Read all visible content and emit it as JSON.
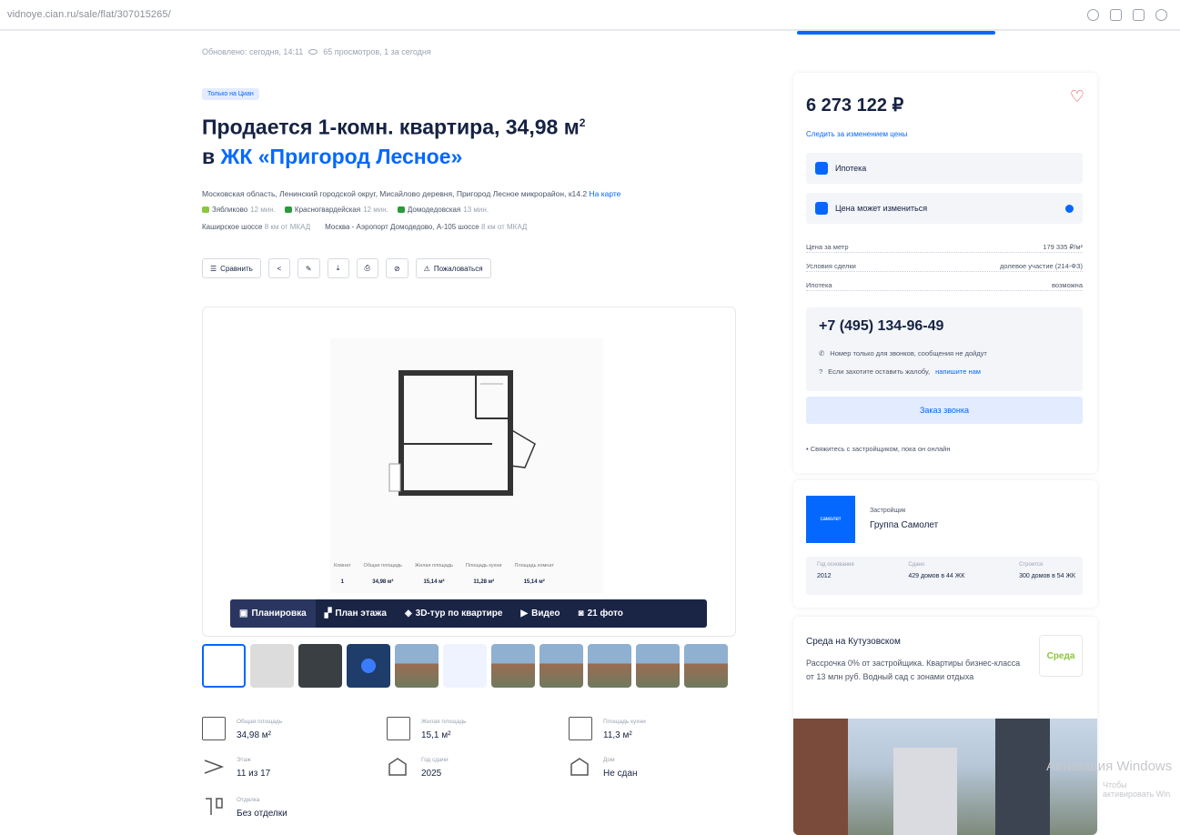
{
  "browser": {
    "url": "vidnoye.cian.ru/sale/flat/307015265/"
  },
  "listing": {
    "updated": "Обновлено: сегодня, 14:11",
    "views": "65 просмотров, 1 за сегодня",
    "badge": "Только на Циан",
    "title_line1": "Продается 1-комн. квартира, 34,98 м",
    "title_sup": "2",
    "title_prefix2": "в ",
    "complex": "ЖК «Пригород Лесное»",
    "address": "Московская область, Ленинский городской округ, Мисайлово деревня, Пригород Лесное микрорайон, к14.2",
    "map_link": "На карте",
    "metro": [
      {
        "name": "Зябликово",
        "time": "12 мин.",
        "color": "#8cc63f"
      },
      {
        "name": "Красногвардейская",
        "time": "12 мин.",
        "color": "#2b9a3c"
      },
      {
        "name": "Домодедовская",
        "time": "13 мин.",
        "color": "#2b9a3c"
      }
    ],
    "highways": [
      {
        "name": "Каширское шоссе",
        "dist": "8 км от МКАД"
      },
      {
        "name": "Москва - Аэропорт Домодедово, А-105 шоссе",
        "dist": "8 км от МКАД"
      }
    ],
    "actions": {
      "compare": "Сравнить",
      "complain": "Пожаловаться"
    },
    "plan_stats": [
      {
        "label": "Комнат",
        "value": "1"
      },
      {
        "label": "Общая площадь",
        "value": "34,98 м²"
      },
      {
        "label": "Жилая площадь",
        "value": "15,14 м²"
      },
      {
        "label": "Площадь кухни",
        "value": "11,28 м²"
      },
      {
        "label": "Площадь комнат",
        "value": "15,14 м²"
      }
    ],
    "media_tabs": [
      "Планировка",
      "План этажа",
      "3D-тур по квартире",
      "Видео",
      "21 фото"
    ],
    "facts": [
      {
        "label": "Общая площадь",
        "value": "34,98 м²"
      },
      {
        "label": "Жилая площадь",
        "value": "15,1 м²"
      },
      {
        "label": "Площадь кухни",
        "value": "11,3 м²"
      },
      {
        "label": "Этаж",
        "value": "11 из 17"
      },
      {
        "label": "Год сдачи",
        "value": "2025"
      },
      {
        "label": "Дом",
        "value": "Не сдан"
      },
      {
        "label": "Отделка",
        "value": "Без отделки"
      }
    ]
  },
  "sidebar": {
    "price": "6 273 122 ₽",
    "follow_price": "Следить за изменением цены",
    "mortgage": "Ипотека",
    "price_may_change": "Цена может измениться",
    "details": [
      {
        "k": "Цена за метр",
        "v": "179 335 ₽/м²"
      },
      {
        "k": "Условия сделки",
        "v": "долевое участие (214-ФЗ)"
      },
      {
        "k": "Ипотека",
        "v": "возможна"
      }
    ],
    "phone": "+7 (495) 134-96-49",
    "phone_note": "Номер только для звонков, сообщения не дойдут",
    "complaint_note": "Если захотите оставить жалобу,",
    "complaint_link": "напишите нам",
    "callback": "Заказ звонка",
    "online": "Свяжитесь с застройщиком, пока он онлайн",
    "developer": {
      "logo_text": "самолет",
      "label": "Застройщик",
      "name": "Группа Самолет",
      "stats": [
        {
          "l": "Год основания",
          "v": "2012"
        },
        {
          "l": "Сдано",
          "v": "429 домов в 44 ЖК"
        },
        {
          "l": "Строится",
          "v": "300 домов в 54 ЖК"
        }
      ]
    },
    "ad": {
      "title": "Среда на Кутузовском",
      "text": "Рассрочка 0% от застройщика. Квартиры бизнес-класса от 13 млн руб. Водный сад с зонами отдыха",
      "logo": "Среда"
    }
  },
  "watermark": {
    "line1": "Активация Windows",
    "line2": "Чтобы активировать Win"
  }
}
